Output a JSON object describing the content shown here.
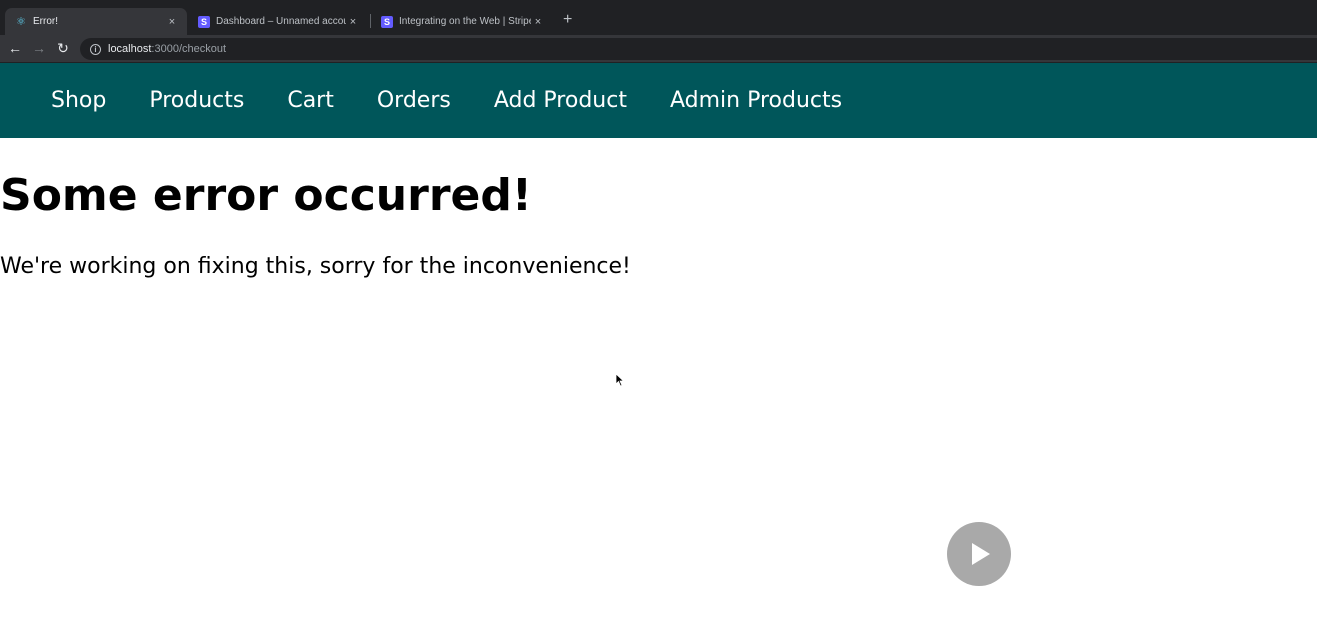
{
  "browser": {
    "tabs": [
      {
        "title": "Error!",
        "favicon": "react-icon",
        "active": true
      },
      {
        "title": "Dashboard – Unnamed accoun",
        "favicon": "stripe-icon",
        "active": false
      },
      {
        "title": "Integrating on the Web | Stripe",
        "favicon": "stripe-icon",
        "active": false
      }
    ],
    "new_tab": "+",
    "close_glyph": "×",
    "url_host": "localhost",
    "url_path": ":3000/checkout",
    "back_glyph": "←",
    "forward_glyph": "→",
    "reload_glyph": "↻",
    "info_glyph": "i"
  },
  "nav": {
    "items": [
      "Shop",
      "Products",
      "Cart",
      "Orders",
      "Add Product",
      "Admin Products"
    ]
  },
  "main": {
    "heading": "Some error occurred!",
    "message": "We're working on fixing this, sorry for the inconvenience!"
  },
  "overlay": {
    "play_icon": "play-icon"
  },
  "colors": {
    "nav_bg": "#00565a",
    "chrome_dark": "#202124",
    "chrome_toolbar": "#35363a",
    "stripe": "#635bff",
    "play_bg": "#a9a9a9"
  }
}
